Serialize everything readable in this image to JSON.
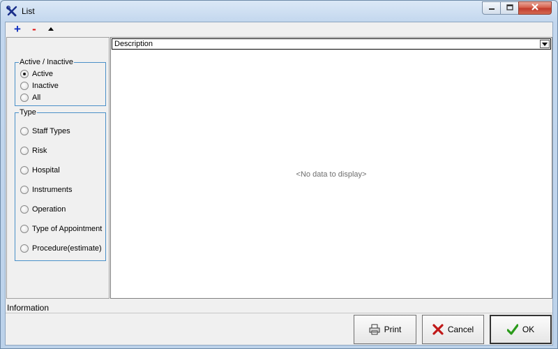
{
  "window": {
    "title": "List",
    "icon": "tools-icon",
    "controls": [
      "minimize-icon",
      "maximize-icon",
      "close-icon"
    ]
  },
  "toolbar": {
    "add": "+",
    "remove": "-",
    "move_up_icon": "triangle-up-icon"
  },
  "filters": {
    "status": {
      "legend": "Active / Inactive",
      "selected": "Active",
      "options": [
        "Active",
        "Inactive",
        "All"
      ]
    },
    "type": {
      "legend": "Type",
      "options": [
        "Staff Types",
        "Risk",
        "Hospital",
        "Instruments",
        "Operation",
        "Type of Appointment",
        "Procedure(estimate)"
      ]
    }
  },
  "grid": {
    "column": "Description",
    "empty_text": "<No data to display>"
  },
  "info": {
    "label": "Information"
  },
  "buttons": {
    "print": "Print",
    "cancel": "Cancel",
    "ok": "OK"
  },
  "colors": {
    "group_border": "#4a90c8",
    "add": "#1030c0",
    "remove": "#e01010",
    "cancel_icon": "#c01818",
    "ok_icon": "#2a9a1a"
  }
}
